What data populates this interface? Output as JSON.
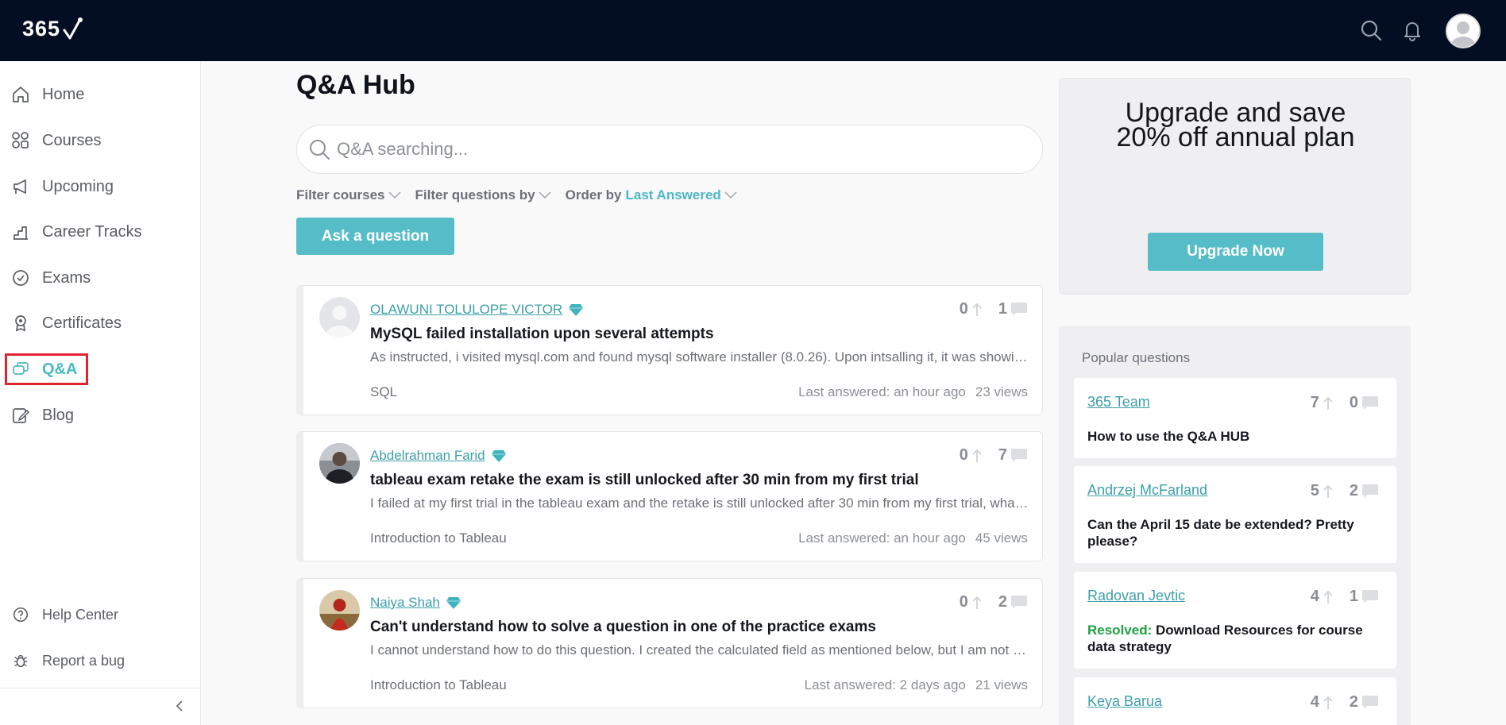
{
  "header": {
    "logo_text": "365",
    "icons": [
      "search-icon",
      "bell-icon",
      "avatar"
    ]
  },
  "sidebar": {
    "items": [
      {
        "label": "Home",
        "icon": "home-icon"
      },
      {
        "label": "Courses",
        "icon": "courses-icon"
      },
      {
        "label": "Upcoming",
        "icon": "megaphone-icon"
      },
      {
        "label": "Career Tracks",
        "icon": "career-tracks-icon"
      },
      {
        "label": "Exams",
        "icon": "exams-icon"
      },
      {
        "label": "Certificates",
        "icon": "certificate-icon"
      },
      {
        "label": "Q&A",
        "icon": "qa-icon",
        "active": true
      },
      {
        "label": "Blog",
        "icon": "blog-icon"
      }
    ],
    "footer": [
      {
        "label": "Help Center",
        "icon": "help-icon"
      },
      {
        "label": "Report a bug",
        "icon": "bug-icon"
      }
    ]
  },
  "main": {
    "title": "Q&A Hub",
    "search_placeholder": "Q&A searching...",
    "filters": {
      "courses": "Filter courses",
      "questions": "Filter questions by",
      "order_label": "Order by",
      "order_value": "Last Answered"
    },
    "ask_button": "Ask a question",
    "questions": [
      {
        "author": "OLAWUNI TOLULOPE VICTOR",
        "title": "MySQL failed installation upon several attempts",
        "excerpt": "As instructed, i visited mysql.com and found mysql software installer (8.0.26). Upon intsalling it, it was showing an error message",
        "course": "SQL",
        "last_answered": "Last answered: an hour ago",
        "views": "23 views",
        "votes": "0",
        "comments": "1"
      },
      {
        "author": "Abdelrahman Farid",
        "title": "tableau exam retake the exam is still unlocked after 30 min from my first trial",
        "excerpt": "I failed at my first trial in the tableau exam and the retake is still unlocked after 30 min from my first trial, what should I do",
        "course": "Introduction to Tableau",
        "last_answered": "Last answered: an hour ago",
        "views": "45 views",
        "votes": "0",
        "comments": "7"
      },
      {
        "author": "Naiya Shah",
        "title": "Can't understand how to solve a question in one of the practice exams",
        "excerpt": "I cannot understand how to do this question. I created the calculated field as mentioned below, but I am not getting the answer",
        "course": "Introduction to Tableau",
        "last_answered": "Last answered: 2 days ago",
        "views": "21 views",
        "votes": "0",
        "comments": "2"
      }
    ]
  },
  "promo": {
    "title_line1": "Upgrade and save",
    "title_line2": "20% off annual plan",
    "button": "Upgrade Now"
  },
  "popular": {
    "heading": "Popular questions",
    "items": [
      {
        "author": "365 Team",
        "votes": "7",
        "comments": "0",
        "text": "How to use the Q&A HUB",
        "resolved": ""
      },
      {
        "author": "Andrzej McFarland",
        "votes": "5",
        "comments": "2",
        "text": "Can the April 15 date be extended? Pretty please?",
        "resolved": ""
      },
      {
        "author": "Radovan Jevtic",
        "votes": "4",
        "comments": "1",
        "text": "Download Resources for course data strategy",
        "resolved": "Resolved:"
      },
      {
        "author": "Keya Barua",
        "votes": "4",
        "comments": "2",
        "text": "",
        "resolved": ""
      }
    ]
  },
  "colors": {
    "accent": "#56bdc8",
    "header_bg": "#030e22",
    "resolved": "#1ea03f",
    "active_outline": "#e0242e"
  }
}
